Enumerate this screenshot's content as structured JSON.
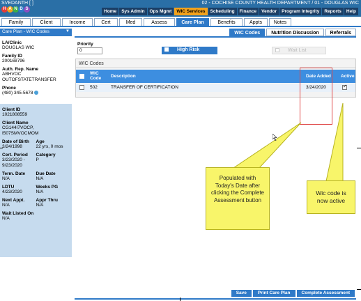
{
  "topbar": {
    "user": "SVEDANTH [              ]",
    "department": "02 - COCHISE COUNTY HEALTH DEPARTMENT / 01 - DOUGLAS WIC",
    "logo_letters": [
      "H",
      "A",
      "N",
      "D",
      "S"
    ],
    "nav": [
      "Home",
      "Sys Admin",
      "Ops Mgmt",
      "WIC Services",
      "Scheduling",
      "Finance",
      "Vendor",
      "Program Integrity",
      "Reports",
      "Help"
    ],
    "active_nav": "WIC Services"
  },
  "tabs": [
    "Family",
    "Client",
    "Income",
    "Cert",
    "Med",
    "Assess",
    "Care Plan",
    "Benefits",
    "Appts",
    "Notes"
  ],
  "active_tab": "Care Plan",
  "left_panel": {
    "selector": "Care Plan - WIC Codes",
    "la_clinic_label": "LA/Clinic",
    "la_clinic": "DOUGLAS WIC",
    "family_id_label": "Family ID",
    "family_id": "200168796",
    "auth_rep_label": "Auth. Rep. Name",
    "auth_rep_1": "ABHVOC",
    "auth_rep_2": "OUTOFSTATETRANSFER",
    "phone_label": "Phone",
    "phone": "(480) 345-5678",
    "client_id_label": "Client ID",
    "client_id": "1021808559",
    "client_name_label": "Client Name",
    "client_name_1": "CG144I7VOCP,",
    "client_name_2": "I507SMVOCMOM",
    "dob_label": "Date of Birth",
    "dob": "3/24/1998",
    "age_label": "Age",
    "age": "22 yrs, 0 mos",
    "cert_period_label": "Cert. Period",
    "cert_period_1": "3/23/2020 -",
    "cert_period_2": "9/23/2020",
    "category_label": "Category",
    "category": "P",
    "term_date_label": "Term. Date",
    "term_date": "N/A",
    "due_date_label": "Due Date",
    "due_date": "N/A",
    "ldtu_label": "LDTU",
    "ldtu": "4/23/2020",
    "weeks_pg_label": "Weeks PG",
    "weeks_pg": "N/A",
    "next_appt_label": "Next Appt.",
    "next_appt": "N/A",
    "appr_thru_label": "Appr Thru",
    "appr_thru": "N/A",
    "wait_listed_label": "Wait Listed On",
    "wait_listed": "N/A"
  },
  "subtabs": [
    "WIC Codes",
    "Nutrition Discussion",
    "Referrals"
  ],
  "active_subtab": "WIC Codes",
  "priority": {
    "label": "Priority",
    "value": "0"
  },
  "high_risk_label": "High Risk",
  "wait_list_label": "Wait List",
  "wic_codes": {
    "section_title": "WIC Codes",
    "headers": {
      "code_1": "WIC",
      "code_2": "Code",
      "description": "Description",
      "date_added": "Date Added",
      "active": "Active"
    },
    "rows": [
      {
        "code": "502",
        "description": "TRANSFER OF CERTIFICATION",
        "date_added": "3/24/2020",
        "active": true
      }
    ]
  },
  "buttons": {
    "save": "Save",
    "print": "Print Care Plan",
    "complete": "Complete Assessment"
  },
  "callouts": {
    "date": "Populated with Today's Date after clicking the Complete Assessment button",
    "active": "Wic code is now active"
  },
  "colors": {
    "topbar": "#2a6fa6",
    "accent": "#2f7ac8",
    "nav_active": "#f2a21c",
    "callout": "#f8f56a",
    "highlight": "#e04848"
  }
}
